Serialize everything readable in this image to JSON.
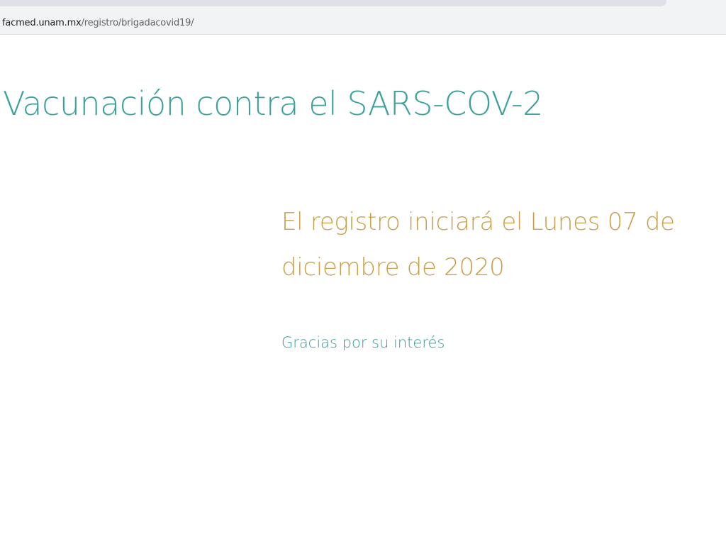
{
  "browser": {
    "url_domain": "facmed.unam.mx",
    "url_path": "/registro/brigadacovid19/"
  },
  "page": {
    "title": "Vacunación contra el SARS-COV-2",
    "notice_line1": "El registro iniciará el Lunes 07 de",
    "notice_line2": "diciembre de 2020",
    "thanks": "Gracias por su interés"
  },
  "colors": {
    "title": "#3aa29a",
    "notice": "#c9a04a",
    "thanks": "#3a9a9a"
  }
}
